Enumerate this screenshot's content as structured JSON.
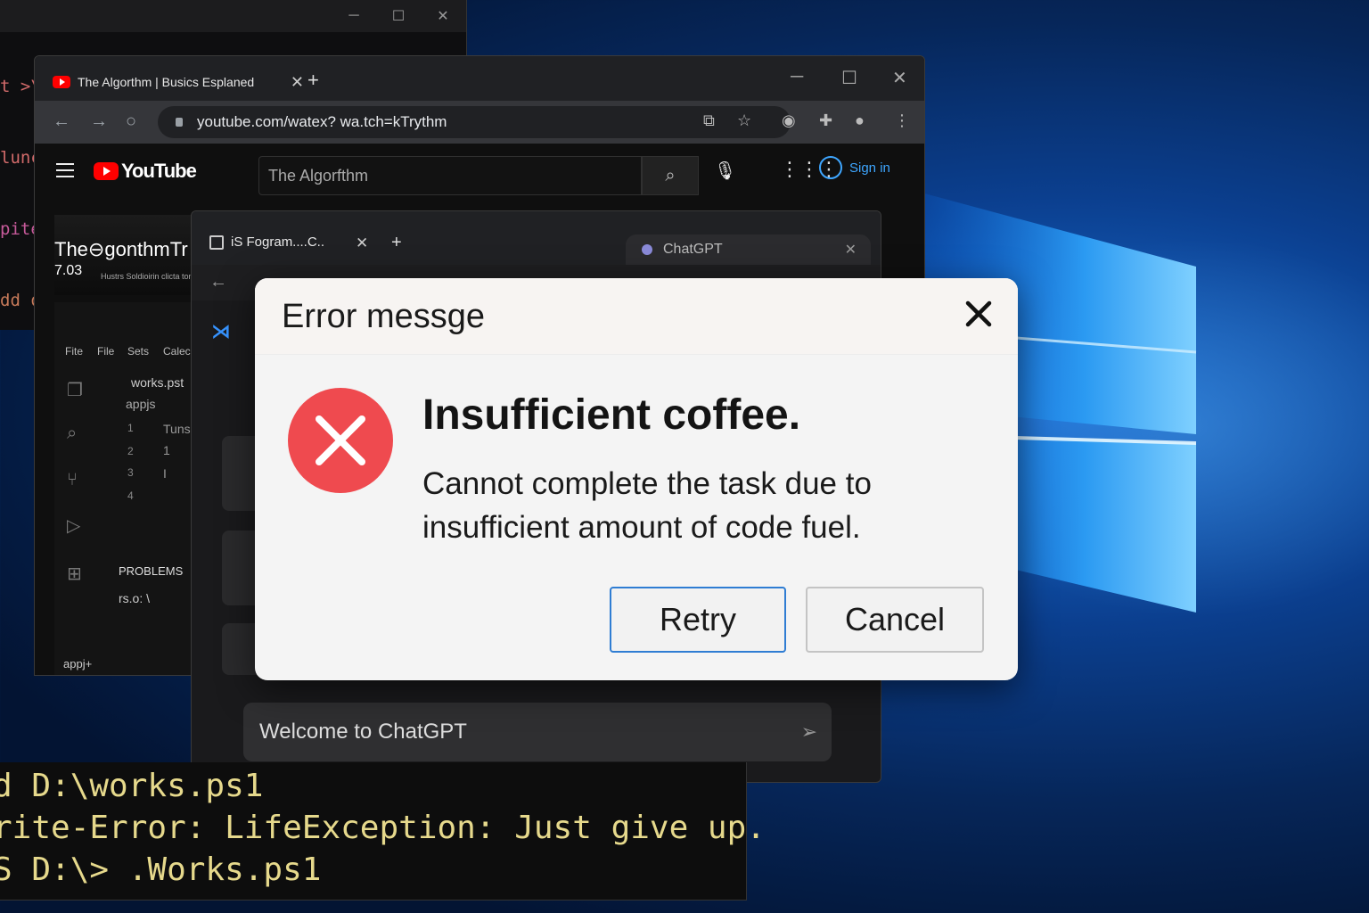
{
  "desktop": {
    "accent": "#0b5fc9"
  },
  "back_terminal": {
    "lines": [
      "t >\\",
      "lunc",
      "pite",
      "dd o"
    ],
    "colors": [
      "#d16a6a",
      "#d16a6a",
      "#c65a9a",
      "#c77a5a"
    ]
  },
  "bottom_terminal": {
    "lines": [
      "d D:\\works.ps1",
      "rite-Error:  LifeException: Just give up.",
      "S D:\\>  .Works.ps1"
    ]
  },
  "youtube_browser": {
    "tab_title": "The Algorthm | Busics Esplaned",
    "address": "youtube.com/watex? wa.tch=kTrythm",
    "search_value": "The Algorfthm",
    "logo_text": "YouTube",
    "sign_in": "Sign in",
    "video_title": "The⊖gonthmTr",
    "video_duration": "7.03",
    "video_subtitle": "Hustrs Soldioirin clicta ton",
    "editor": {
      "menu": [
        "Fite",
        "File",
        "Sets",
        "Calec"
      ],
      "file": "works.pst",
      "folder": "appjs",
      "line_numbers": [
        "1",
        "2",
        "3",
        "4"
      ],
      "code": [
        "Tuns",
        "1",
        "I"
      ],
      "problems_label": "PROBLEMS",
      "problems_text": "rs.o: \\",
      "status": "appj+"
    }
  },
  "chat_window": {
    "tab1_title": "iS Fogram....C..",
    "tab2_title": "ChatGPT",
    "input_placeholder": "Welcome to ChatGPT"
  },
  "error_dialog": {
    "title": "Error messge",
    "heading": "Insufficient coffee.",
    "body": "Cannot complete the task due to insufficient amount of code fuel.",
    "retry_label": "Retry",
    "cancel_label": "Cancel",
    "icon_color": "#ef4a4f"
  }
}
